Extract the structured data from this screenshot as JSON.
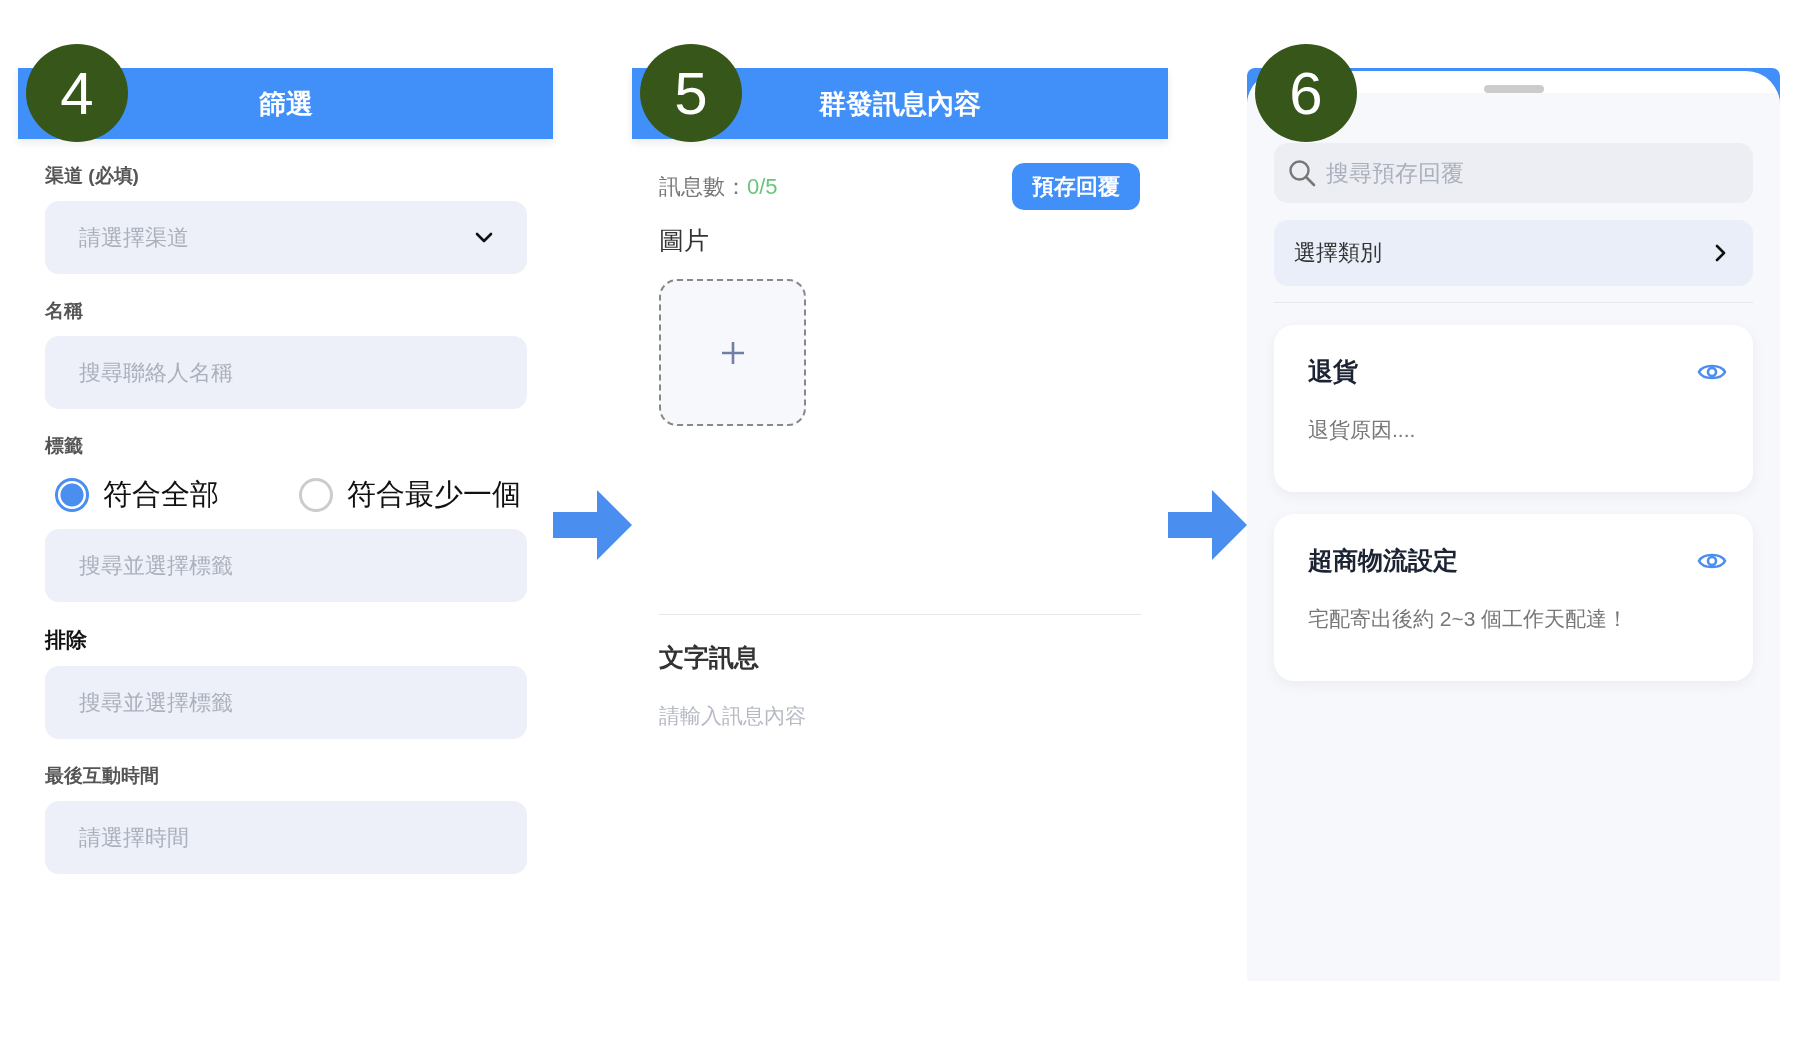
{
  "filter_panel": {
    "badge": "4",
    "title": "篩選",
    "fields": [
      {
        "kind": "select",
        "label": "渠道 (必填)",
        "emphasis": false,
        "placeholder": "請選擇渠道"
      },
      {
        "kind": "text",
        "label": "名稱",
        "emphasis": false,
        "placeholder": "搜尋聯絡人名稱"
      },
      {
        "kind": "radio",
        "label": "標籤",
        "emphasis": false,
        "options": [
          {
            "label": "符合全部",
            "selected": true
          },
          {
            "label": "符合最少一個",
            "selected": false
          }
        ],
        "placeholder": "搜尋並選擇標籤"
      },
      {
        "kind": "text",
        "label": "排除",
        "emphasis": true,
        "placeholder": "搜尋並選擇標籤"
      },
      {
        "kind": "text",
        "label": "最後互動時間",
        "emphasis": false,
        "placeholder": "請選擇時間"
      }
    ]
  },
  "message_panel": {
    "badge": "5",
    "title": "群發訊息內容",
    "count_label": "訊息數：",
    "count_value": "0/5",
    "button": "預存回覆",
    "image_label": "圖片",
    "text_label": "文字訊息",
    "placeholder": "請輸入訊息內容"
  },
  "reply_sheet": {
    "badge": "6",
    "search_placeholder": "搜尋預存回覆",
    "category": "選擇類別",
    "cards": [
      {
        "title": "退貨",
        "body": "退貨原因...."
      },
      {
        "title": "超商物流設定",
        "body": "宅配寄出後約 2~3 個工作天配達！"
      }
    ]
  }
}
